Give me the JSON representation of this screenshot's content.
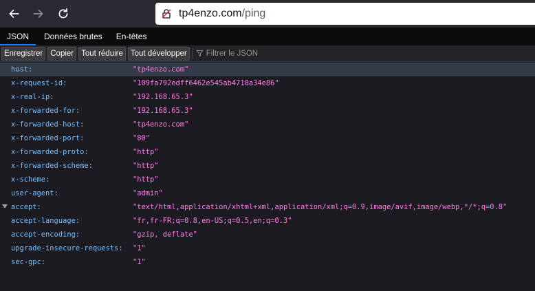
{
  "browser": {
    "url_host": "tp4enzo.com",
    "url_path": "/ping",
    "icons": [
      "back-arrow-icon",
      "forward-arrow-icon",
      "reload-icon",
      "insecure-lock-icon"
    ]
  },
  "tabs": [
    {
      "label": "JSON",
      "active": true
    },
    {
      "label": "Données brutes",
      "active": false
    },
    {
      "label": "En-têtes",
      "active": false
    }
  ],
  "toolbar": {
    "save_label": "Enregistrer",
    "copy_label": "Copier",
    "collapse_all_label": "Tout réduire",
    "expand_all_label": "Tout développer",
    "filter_placeholder": "Filtrer le JSON"
  },
  "rows": [
    {
      "key": "host:",
      "value": "\"tp4enzo.com\""
    },
    {
      "key": "x-request-id:",
      "value": "\"109fa792edff6462e545ab4718a34e86\""
    },
    {
      "key": "x-real-ip:",
      "value": "\"192.168.65.3\""
    },
    {
      "key": "x-forwarded-for:",
      "value": "\"192.168.65.3\""
    },
    {
      "key": "x-forwarded-host:",
      "value": "\"tp4enzo.com\""
    },
    {
      "key": "x-forwarded-port:",
      "value": "\"80\""
    },
    {
      "key": "x-forwarded-proto:",
      "value": "\"http\""
    },
    {
      "key": "x-forwarded-scheme:",
      "value": "\"http\""
    },
    {
      "key": "x-scheme:",
      "value": "\"http\""
    },
    {
      "key": "user-agent:",
      "value": "\"admin\""
    },
    {
      "key": "accept:",
      "value": "\"text/html,application/xhtml+xml,application/xml;q=0.9,image/avif,image/webp,*/*;q=0.8\""
    },
    {
      "key": "accept-language:",
      "value": "\"fr,fr-FR;q=0.8,en-US;q=0.5,en;q=0.3\""
    },
    {
      "key": "accept-encoding:",
      "value": "\"gzip, deflate\""
    },
    {
      "key": "upgrade-insecure-requests:",
      "value": "\"1\""
    },
    {
      "key": "sec-gpc:",
      "value": "\"1\""
    }
  ],
  "colors": {
    "key": "#75bfff",
    "string_value": "#ff7de9",
    "background": "#1c1b22",
    "selected_row": "#353b48",
    "active_tab_indicator": "#0a84ff"
  }
}
